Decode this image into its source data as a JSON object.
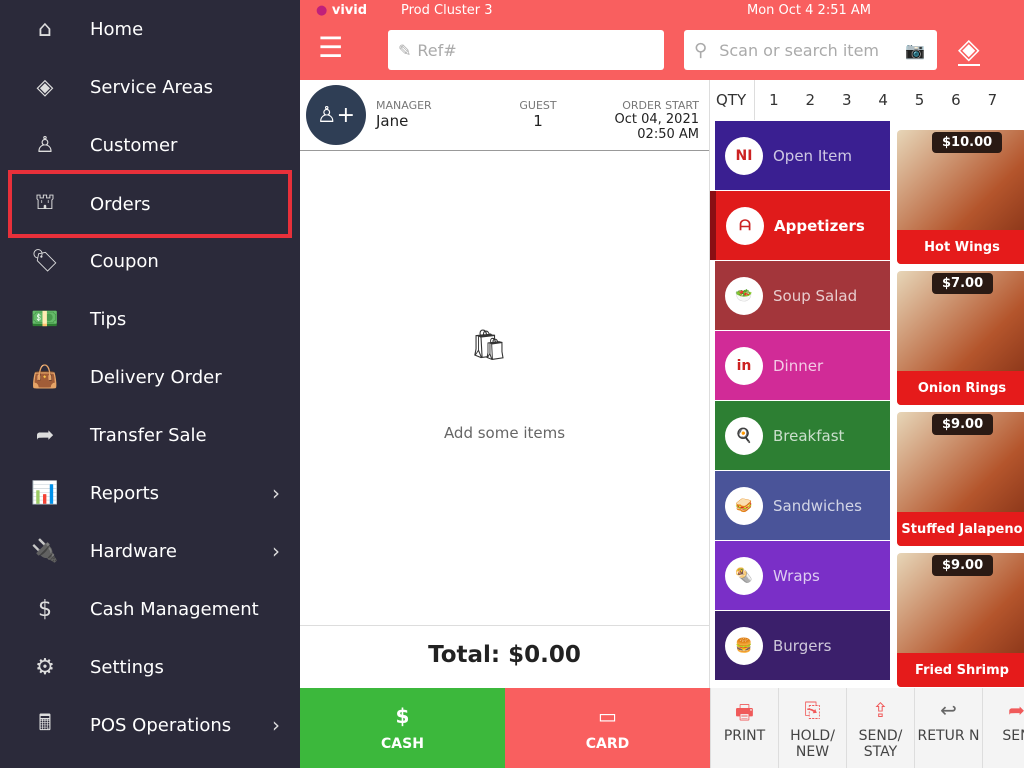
{
  "sidebar": {
    "items": [
      {
        "label": "Home",
        "icon": "home-icon",
        "glyph": "⌂"
      },
      {
        "label": "Service Areas",
        "icon": "layers-icon",
        "glyph": "◈"
      },
      {
        "label": "Customer",
        "icon": "user-icon",
        "glyph": "♙"
      },
      {
        "label": "Orders",
        "icon": "cloche-icon",
        "glyph": "⛫",
        "active": true
      },
      {
        "label": "Coupon",
        "icon": "coupon-icon",
        "glyph": "🏷"
      },
      {
        "label": "Tips",
        "icon": "cash-icon",
        "glyph": "💵"
      },
      {
        "label": "Delivery Order",
        "icon": "delivery-bag-icon",
        "glyph": "👜"
      },
      {
        "label": "Transfer Sale",
        "icon": "share-arrow-icon",
        "glyph": "➦"
      },
      {
        "label": "Reports",
        "icon": "report-icon",
        "glyph": "📊",
        "chevron": true
      },
      {
        "label": "Hardware",
        "icon": "plug-icon",
        "glyph": "🔌",
        "chevron": true
      },
      {
        "label": "Cash Management",
        "icon": "dollar-icon",
        "glyph": "$"
      },
      {
        "label": "Settings",
        "icon": "lifebuoy-icon",
        "glyph": "⚙"
      },
      {
        "label": "POS Operations",
        "icon": "register-icon",
        "glyph": "🖩",
        "chevron": true
      }
    ]
  },
  "topbar": {
    "brand": "vivid",
    "cluster": "Prod Cluster 3",
    "datetime": "Mon Oct 4 2:51 AM",
    "ref_placeholder": "Ref#",
    "search_placeholder": "Scan or search item"
  },
  "order": {
    "manager_label": "MANAGER",
    "manager": "Jane",
    "guest_label": "GUEST",
    "guest": "1",
    "start_label": "ORDER START",
    "start_date": "Oct 04, 2021",
    "start_time": "02:50 AM",
    "empty_text": "Add some items",
    "total": "Total: $0.00"
  },
  "qty": {
    "label": "QTY",
    "values": [
      "1",
      "2",
      "3",
      "4",
      "5",
      "6",
      "7"
    ]
  },
  "categories": [
    {
      "label": "Open Item",
      "color": "#3a1f91",
      "thumb": "NI"
    },
    {
      "label": "Appetizers",
      "color": "#e01b1b",
      "thumb": "ᗩ",
      "selected": true
    },
    {
      "label": "Soup Salad",
      "color": "#a3363b",
      "thumb": "🥗"
    },
    {
      "label": "Dinner",
      "color": "#d12b97",
      "thumb": "in"
    },
    {
      "label": "Breakfast",
      "color": "#2d7f33",
      "thumb": "🍳"
    },
    {
      "label": "Sandwiches",
      "color": "#4a5499",
      "thumb": "🥪"
    },
    {
      "label": "Wraps",
      "color": "#7a2fc7",
      "thumb": "🌯"
    },
    {
      "label": "Burgers",
      "color": "#3b1f6b",
      "thumb": "🍔"
    }
  ],
  "items": [
    {
      "name": "Hot Wings",
      "price": "$10.00"
    },
    {
      "name": "Onion Rings",
      "price": "$7.00"
    },
    {
      "name": "Stuffed Jalapeno",
      "price": "$9.00"
    },
    {
      "name": "Fried Shrimp",
      "price": "$9.00"
    }
  ],
  "payment": {
    "cash": "CASH",
    "card": "CARD"
  },
  "actions": [
    {
      "label": "PRINT",
      "icon": "printer-icon",
      "glyph": "🖶"
    },
    {
      "label": "HOLD/ NEW",
      "icon": "hold-new-icon",
      "glyph": "⎘"
    },
    {
      "label": "SEND/ STAY",
      "icon": "send-stay-icon",
      "glyph": "⇪"
    },
    {
      "label": "RETUR N",
      "icon": "return-icon",
      "glyph": "↩"
    },
    {
      "label": "SEN",
      "icon": "send-icon",
      "glyph": "➦"
    }
  ],
  "colors": {
    "accent": "#f95f5f",
    "sidebar": "#2b2a3a",
    "cash": "#3cb83c",
    "highlight": "#e8303a"
  }
}
